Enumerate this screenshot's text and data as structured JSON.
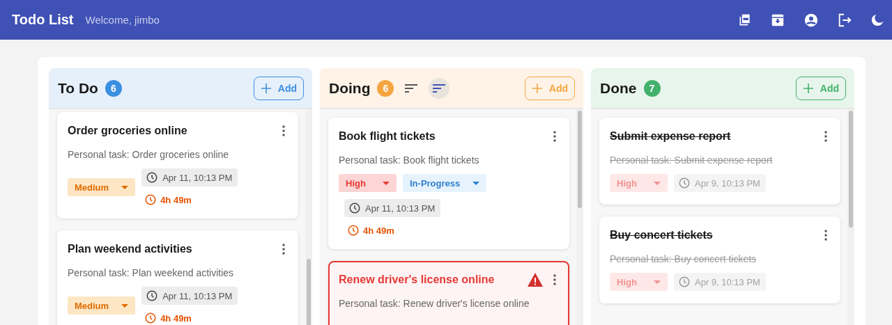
{
  "app_bar": {
    "title": "Todo List",
    "welcome": "Welcome, jimbo"
  },
  "columns": [
    {
      "title": "To Do",
      "count": "6",
      "color": "#3b8fe0",
      "add_label": "Add",
      "cards": [
        {
          "title": "Order groceries online",
          "description": "Personal task: Order groceries online",
          "completed": false,
          "overdue": false,
          "priority": {
            "label": "Medium",
            "kind": "medium"
          },
          "due": "Apr 11, 10:13 PM",
          "remaining": "4h 49m"
        },
        {
          "title": "Plan weekend activities",
          "description": "Personal task: Plan weekend activities",
          "completed": false,
          "overdue": false,
          "priority": {
            "label": "Medium",
            "kind": "medium"
          },
          "due": "Apr 11, 10:13 PM",
          "remaining": "4h 49m"
        }
      ]
    },
    {
      "title": "Doing",
      "count": "6",
      "color": "#f5a53f",
      "add_label": "Add",
      "sort_buttons": [
        {
          "selected": false
        },
        {
          "selected": true
        }
      ],
      "cards": [
        {
          "title": "Book flight tickets",
          "description": "Personal task: Book flight tickets",
          "completed": false,
          "overdue": false,
          "priority": {
            "label": "High",
            "kind": "high"
          },
          "status": {
            "label": "In-Progress",
            "kind": "in-progress"
          },
          "due": "Apr 11, 10:13 PM",
          "remaining": "4h 49m"
        },
        {
          "title": "Renew driver's license online",
          "description": "Personal task: Renew driver's license online",
          "completed": false,
          "overdue": true
        }
      ]
    },
    {
      "title": "Done",
      "count": "7",
      "color": "#43b16b",
      "add_label": "Add",
      "cards": [
        {
          "title": "Submit expense report",
          "description": "Personal task: Submit expense report",
          "completed": true,
          "overdue": false,
          "priority": {
            "label": "High",
            "kind": "high"
          },
          "due": "Apr 9, 10:13 PM"
        },
        {
          "title": "Buy concert tickets",
          "description": "Personal task: Buy concert tickets",
          "completed": true,
          "overdue": false,
          "priority": {
            "label": "High",
            "kind": "high"
          },
          "due": "Apr 9, 10:13 PM"
        }
      ]
    }
  ]
}
